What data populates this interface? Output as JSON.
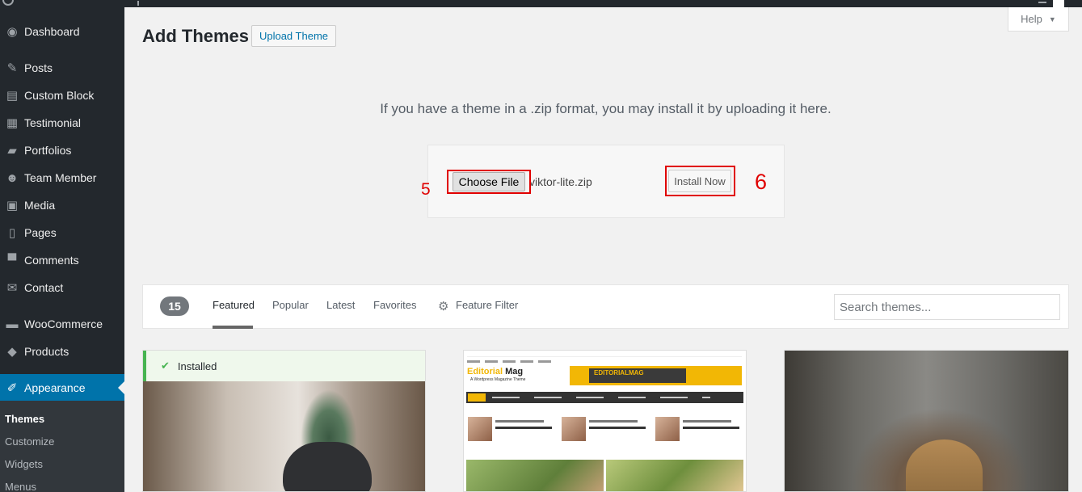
{
  "sidebar": {
    "items": [
      {
        "label": "Dashboard",
        "icon": "dashboard-icon",
        "glyph": "◉"
      },
      {
        "label": "Posts",
        "icon": "pin-icon",
        "glyph": "✎"
      },
      {
        "label": "Custom Block",
        "icon": "block-icon",
        "glyph": "▤"
      },
      {
        "label": "Testimonial",
        "icon": "comment-lines-icon",
        "glyph": "▦"
      },
      {
        "label": "Portfolios",
        "icon": "folder-icon",
        "glyph": "▰"
      },
      {
        "label": "Team Member",
        "icon": "group-icon",
        "glyph": "☻"
      },
      {
        "label": "Media",
        "icon": "media-icon",
        "glyph": "▣"
      },
      {
        "label": "Pages",
        "icon": "pages-icon",
        "glyph": "▯"
      },
      {
        "label": "Comments",
        "icon": "speech-bubble-icon",
        "glyph": "▀"
      },
      {
        "label": "Contact",
        "icon": "envelope-icon",
        "glyph": "✉"
      },
      {
        "label": "WooCommerce",
        "icon": "woo-icon",
        "glyph": "▬"
      },
      {
        "label": "Products",
        "icon": "box-icon",
        "glyph": "◆"
      },
      {
        "label": "Appearance",
        "icon": "brush-icon",
        "glyph": "✐"
      }
    ],
    "submenu": [
      "Themes",
      "Customize",
      "Widgets",
      "Menus"
    ]
  },
  "header": {
    "title": "Add Themes",
    "upload_label": "Upload Theme",
    "help_label": "Help"
  },
  "upload": {
    "description": "If you have a theme in a .zip format, you may install it by uploading it here.",
    "choose_label": "Choose File",
    "file_name": "viktor-lite.zip",
    "install_label": "Install Now",
    "step_choose": "5",
    "step_install": "6"
  },
  "filter": {
    "count": "15",
    "tabs": [
      "Featured",
      "Popular",
      "Latest",
      "Favorites"
    ],
    "feature_filter": "Feature Filter",
    "search_placeholder": "Search themes..."
  },
  "themes": {
    "installed_label": "Installed",
    "preview2": {
      "logo_main": "Editorial",
      "logo_accent": "Mag",
      "tagline": "A Wordpress Magazine Theme",
      "banner": "EDITORIALMAG"
    }
  },
  "colors": {
    "sidebar_bg": "#23282d",
    "accent": "#0073aa",
    "highlight": "#e00000",
    "installed_green": "#46b450"
  }
}
